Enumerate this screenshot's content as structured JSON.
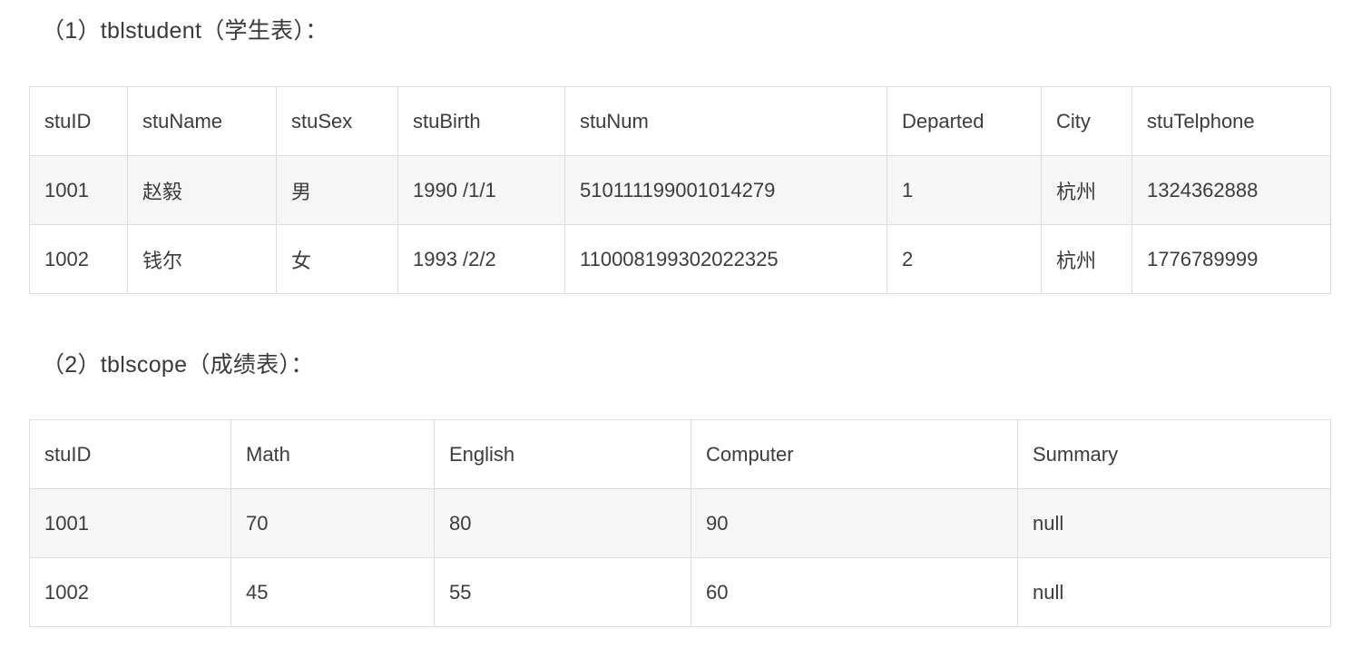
{
  "sections": [
    {
      "heading": "（1）tblstudent（学生表）：",
      "table": {
        "name": "tblstudent",
        "columns": [
          "stuID",
          "stuName",
          "stuSex",
          "stuBirth",
          "stuNum",
          "Departed",
          "City",
          "stuTelphone"
        ],
        "rows": [
          [
            "1001",
            "赵毅",
            "男",
            "1990 /1/1",
            "510111199001014279",
            "1",
            "杭州",
            "1324362888"
          ],
          [
            "1002",
            "钱尔",
            "女",
            "1993 /2/2",
            "110008199302022325",
            "2",
            "杭州",
            "1776789999"
          ]
        ]
      }
    },
    {
      "heading": "（2）tblscope（成绩表）：",
      "table": {
        "name": "tblscope",
        "columns": [
          "stuID",
          "Math",
          "English",
          "Computer",
          "Summary"
        ],
        "rows": [
          [
            "1001",
            "70",
            "80",
            "90",
            "null"
          ],
          [
            "1002",
            "45",
            "55",
            "60",
            "null"
          ]
        ]
      }
    }
  ],
  "colors": {
    "text": "#3c3c3c",
    "border": "#dcdcdc",
    "stripe": "#f6f6f6",
    "background": "#ffffff"
  }
}
